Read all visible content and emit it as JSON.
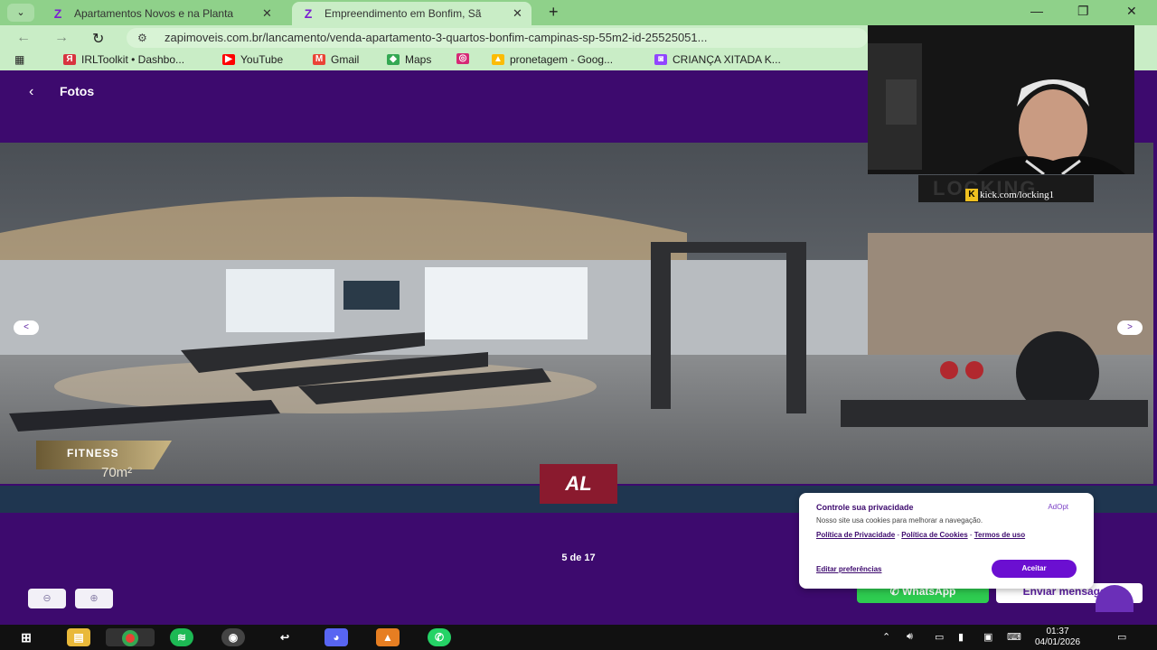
{
  "browser": {
    "tabs": [
      {
        "title": "Apartamentos Novos e na Planta",
        "active": false
      },
      {
        "title": "Empreendimento em Bonfim, Sã",
        "active": true
      }
    ],
    "url": "zapimoveis.com.br/lancamento/venda-apartamento-3-quartos-bonfim-campinas-sp-55m2-id-25525051...",
    "bookmarks": [
      {
        "label": "IRLToolkit • Dashbo...",
        "icon": "irltoolkit-icon",
        "color": "#d8333f"
      },
      {
        "label": "YouTube",
        "icon": "youtube-icon",
        "color": "#ff0000"
      },
      {
        "label": "Gmail",
        "icon": "gmail-icon",
        "color": "#ea4335"
      },
      {
        "label": "Maps",
        "icon": "maps-icon",
        "color": "#34a853"
      },
      {
        "label": "",
        "icon": "instagram-icon",
        "color": "#d62976"
      },
      {
        "label": "pronetagem - Goog...",
        "icon": "google-drive-icon",
        "color": "#fbbc04"
      },
      {
        "label": "CRIANÇA XITADA K...",
        "icon": "twitch-icon",
        "color": "#9146ff"
      }
    ]
  },
  "page": {
    "title": "Fotos",
    "back_icon": "chevron-left-icon",
    "photo": {
      "label": "FITNESS",
      "area": "70m²"
    },
    "counter": "5 de 17",
    "brand_logo": "AL",
    "buttons": {
      "whatsapp": "WhatsApp",
      "message": "Enviar mensagem"
    },
    "gallery_prev": "<",
    "gallery_next": ">"
  },
  "cookie_banner": {
    "title": "Controle sua privacidade",
    "brand": "AdOpt",
    "text": "Nosso site usa cookies para melhorar a navegação.",
    "privacy_link": "Política de Privacidade",
    "cookies_link": "Política de Cookies",
    "terms_link": "Termos de uso",
    "preferences": "Editar preferências",
    "accept": "Aceitar"
  },
  "stream_overlay": {
    "handle": "kick.com/locking1",
    "brand": "LOCKING"
  },
  "taskbar": {
    "time": "01:37",
    "date": "04/01/2026"
  },
  "colors": {
    "page_bg": "#3d0a6e",
    "accent": "#6b0fd1",
    "whatsapp": "#2ecc50",
    "chrome_green": "#8fd18a"
  }
}
